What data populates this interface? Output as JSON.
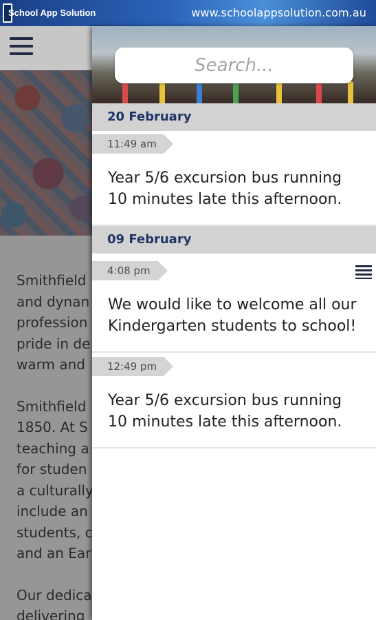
{
  "banner": {
    "title": "School App Solution",
    "url": "www.schoolappsolution.com.au"
  },
  "background": {
    "paragraphs": [
      "Smithfield\nand dynan\nprofession\npride in de\nwarm and",
      "Smithfield\n1850. At S\nteaching a\nfor studen\na culturally\ninclude an\nstudents, c\nand an Ear",
      "Our dedica\ndelivering"
    ]
  },
  "search": {
    "placeholder": "Search..."
  },
  "feed": {
    "groups": [
      {
        "date": "20 February",
        "items": [
          {
            "time": "11:49 am",
            "text": "Year 5/6 excursion bus running 10 minutes late this afternoon."
          }
        ]
      },
      {
        "date": "09 February",
        "items": [
          {
            "time": "4:08 pm",
            "text": "We would like to welcome all our Kindergarten students to school!"
          },
          {
            "time": "12:49 pm",
            "text": "Year 5/6 excursion bus running 10 minutes late this afternoon."
          }
        ]
      }
    ]
  },
  "icons": {
    "menu": "hamburger-menu-icon",
    "list": "list-icon"
  },
  "colors": {
    "banner": "#2b63b8",
    "date_text": "#1f3566",
    "date_bg": "#d2d2d2"
  }
}
